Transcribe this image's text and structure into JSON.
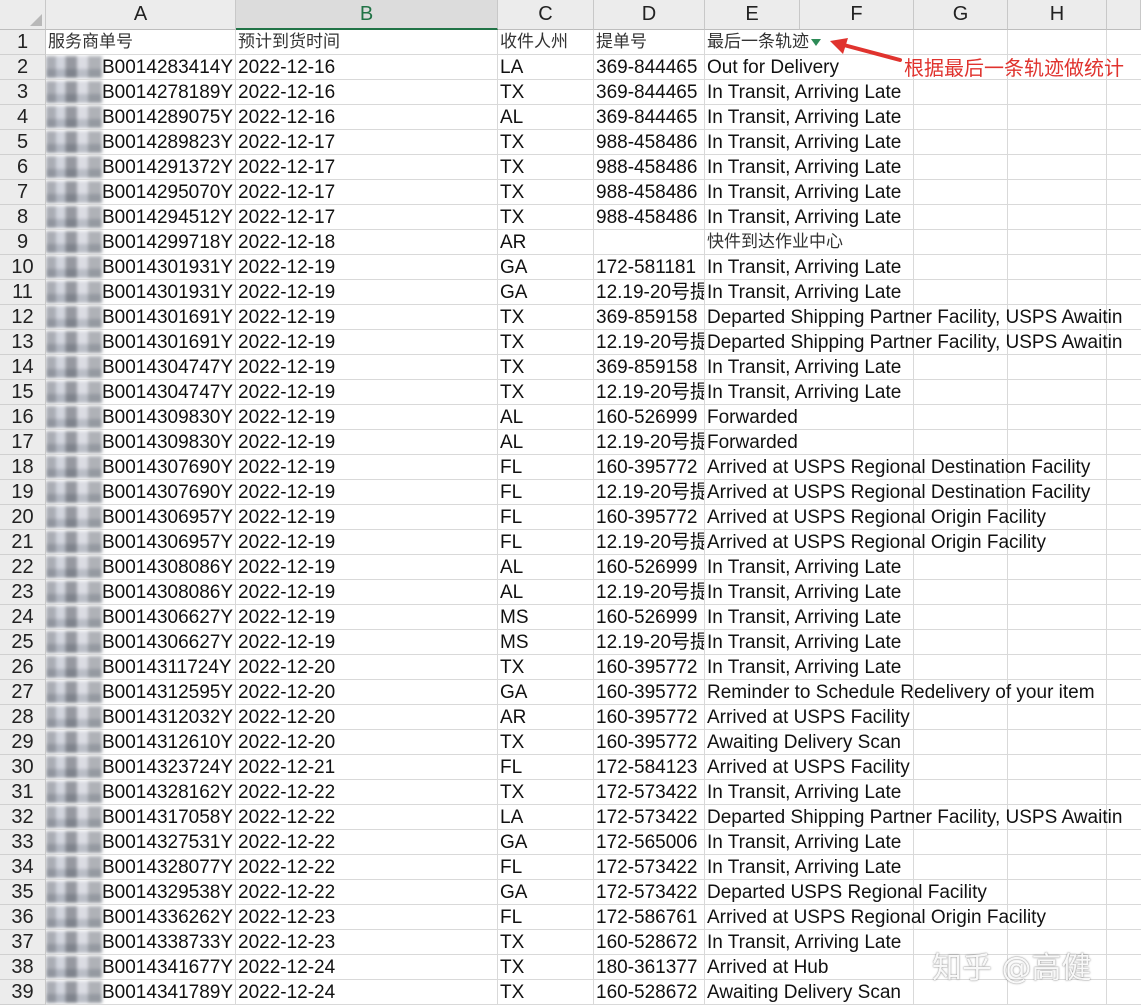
{
  "columns": [
    "A",
    "B",
    "C",
    "D",
    "E",
    "F",
    "G",
    "H"
  ],
  "active_column": "B",
  "header_row": {
    "row_number": "1",
    "a": "服务商单号",
    "b": "预计到货时间",
    "c": "收件人州",
    "d": "提单号",
    "e": "最后一条轨迹"
  },
  "annotation": "根据最后一条轨迹做统计",
  "watermark": "知乎 @高健",
  "rows": [
    {
      "n": "2",
      "a": "B0014283414Y",
      "b": "2022-12-16",
      "c": "LA",
      "d": "369-844465",
      "e": "Out for Delivery"
    },
    {
      "n": "3",
      "a": "B0014278189Y",
      "b": "2022-12-16",
      "c": "TX",
      "d": "369-844465",
      "e": "In Transit, Arriving Late"
    },
    {
      "n": "4",
      "a": "B0014289075Y",
      "b": "2022-12-16",
      "c": "AL",
      "d": "369-844465",
      "e": "In Transit, Arriving Late"
    },
    {
      "n": "5",
      "a": "B0014289823Y",
      "b": "2022-12-17",
      "c": "TX",
      "d": "988-458486",
      "e": "In Transit, Arriving Late"
    },
    {
      "n": "6",
      "a": "B0014291372Y",
      "b": "2022-12-17",
      "c": "TX",
      "d": "988-458486",
      "e": "In Transit, Arriving Late"
    },
    {
      "n": "7",
      "a": "B0014295070Y",
      "b": "2022-12-17",
      "c": "TX",
      "d": "988-458486",
      "e": "In Transit, Arriving Late"
    },
    {
      "n": "8",
      "a": "B0014294512Y",
      "b": "2022-12-17",
      "c": "TX",
      "d": "988-458486",
      "e": "In Transit, Arriving Late"
    },
    {
      "n": "9",
      "a": "B0014299718Y",
      "b": "2022-12-18",
      "c": "AR",
      "d": "",
      "e": "快件到达作业中心"
    },
    {
      "n": "10",
      "a": "B0014301931Y",
      "b": "2022-12-19",
      "c": "GA",
      "d": "172-581181",
      "e": "In Transit, Arriving Late"
    },
    {
      "n": "11",
      "a": "B0014301931Y",
      "b": "2022-12-19",
      "c": "GA",
      "d": "12.19-20号提",
      "e": "In Transit, Arriving Late"
    },
    {
      "n": "12",
      "a": "B0014301691Y",
      "b": "2022-12-19",
      "c": "TX",
      "d": "369-859158",
      "e": "Departed Shipping Partner Facility, USPS Awaitin"
    },
    {
      "n": "13",
      "a": "B0014301691Y",
      "b": "2022-12-19",
      "c": "TX",
      "d": "12.19-20号提",
      "e": "Departed Shipping Partner Facility, USPS Awaitin"
    },
    {
      "n": "14",
      "a": "B0014304747Y",
      "b": "2022-12-19",
      "c": "TX",
      "d": "369-859158",
      "e": "In Transit, Arriving Late"
    },
    {
      "n": "15",
      "a": "B0014304747Y",
      "b": "2022-12-19",
      "c": "TX",
      "d": "12.19-20号提",
      "e": "In Transit, Arriving Late"
    },
    {
      "n": "16",
      "a": "B0014309830Y",
      "b": "2022-12-19",
      "c": "AL",
      "d": "160-526999",
      "e": "Forwarded"
    },
    {
      "n": "17",
      "a": "B0014309830Y",
      "b": "2022-12-19",
      "c": "AL",
      "d": "12.19-20号提",
      "e": "Forwarded"
    },
    {
      "n": "18",
      "a": "B0014307690Y",
      "b": "2022-12-19",
      "c": "FL",
      "d": "160-395772",
      "e": "Arrived at USPS Regional Destination Facility"
    },
    {
      "n": "19",
      "a": "B0014307690Y",
      "b": "2022-12-19",
      "c": "FL",
      "d": "12.19-20号提",
      "e": "Arrived at USPS Regional Destination Facility"
    },
    {
      "n": "20",
      "a": "B0014306957Y",
      "b": "2022-12-19",
      "c": "FL",
      "d": "160-395772",
      "e": "Arrived at USPS Regional Origin Facility"
    },
    {
      "n": "21",
      "a": "B0014306957Y",
      "b": "2022-12-19",
      "c": "FL",
      "d": "12.19-20号提",
      "e": "Arrived at USPS Regional Origin Facility"
    },
    {
      "n": "22",
      "a": "B0014308086Y",
      "b": "2022-12-19",
      "c": "AL",
      "d": "160-526999",
      "e": "In Transit, Arriving Late"
    },
    {
      "n": "23",
      "a": "B0014308086Y",
      "b": "2022-12-19",
      "c": "AL",
      "d": "12.19-20号提",
      "e": "In Transit, Arriving Late"
    },
    {
      "n": "24",
      "a": "B0014306627Y",
      "b": "2022-12-19",
      "c": "MS",
      "d": "160-526999",
      "e": "In Transit, Arriving Late"
    },
    {
      "n": "25",
      "a": "B0014306627Y",
      "b": "2022-12-19",
      "c": "MS",
      "d": "12.19-20号提",
      "e": "In Transit, Arriving Late"
    },
    {
      "n": "26",
      "a": "B0014311724Y",
      "b": "2022-12-20",
      "c": "TX",
      "d": "160-395772",
      "e": "In Transit, Arriving Late"
    },
    {
      "n": "27",
      "a": "B0014312595Y",
      "b": "2022-12-20",
      "c": "GA",
      "d": "160-395772",
      "e": "Reminder to Schedule Redelivery of your item"
    },
    {
      "n": "28",
      "a": "B0014312032Y",
      "b": "2022-12-20",
      "c": "AR",
      "d": "160-395772",
      "e": "Arrived at USPS Facility"
    },
    {
      "n": "29",
      "a": "B0014312610Y",
      "b": "2022-12-20",
      "c": "TX",
      "d": "160-395772",
      "e": "Awaiting Delivery Scan"
    },
    {
      "n": "30",
      "a": "B0014323724Y",
      "b": "2022-12-21",
      "c": "FL",
      "d": "172-584123",
      "e": "Arrived at USPS Facility"
    },
    {
      "n": "31",
      "a": "B0014328162Y",
      "b": "2022-12-22",
      "c": "TX",
      "d": "172-573422",
      "e": "In Transit, Arriving Late"
    },
    {
      "n": "32",
      "a": "B0014317058Y",
      "b": "2022-12-22",
      "c": "LA",
      "d": "172-573422",
      "e": "Departed Shipping Partner Facility, USPS Awaitin"
    },
    {
      "n": "33",
      "a": "B0014327531Y",
      "b": "2022-12-22",
      "c": "GA",
      "d": "172-565006",
      "e": "In Transit, Arriving Late"
    },
    {
      "n": "34",
      "a": "B0014328077Y",
      "b": "2022-12-22",
      "c": "FL",
      "d": "172-573422",
      "e": "In Transit, Arriving Late"
    },
    {
      "n": "35",
      "a": "B0014329538Y",
      "b": "2022-12-22",
      "c": "GA",
      "d": "172-573422",
      "e": "Departed USPS Regional Facility"
    },
    {
      "n": "36",
      "a": "B0014336262Y",
      "b": "2022-12-23",
      "c": "FL",
      "d": "172-586761",
      "e": "Arrived at USPS Regional Origin Facility"
    },
    {
      "n": "37",
      "a": "B0014338733Y",
      "b": "2022-12-23",
      "c": "TX",
      "d": "160-528672",
      "e": "In Transit, Arriving Late"
    },
    {
      "n": "38",
      "a": "B0014341677Y",
      "b": "2022-12-24",
      "c": "TX",
      "d": "180-361377",
      "e": "Arrived at Hub"
    },
    {
      "n": "39",
      "a": "B0014341789Y",
      "b": "2022-12-24",
      "c": "TX",
      "d": "160-528672",
      "e": "Awaiting Delivery Scan"
    }
  ]
}
